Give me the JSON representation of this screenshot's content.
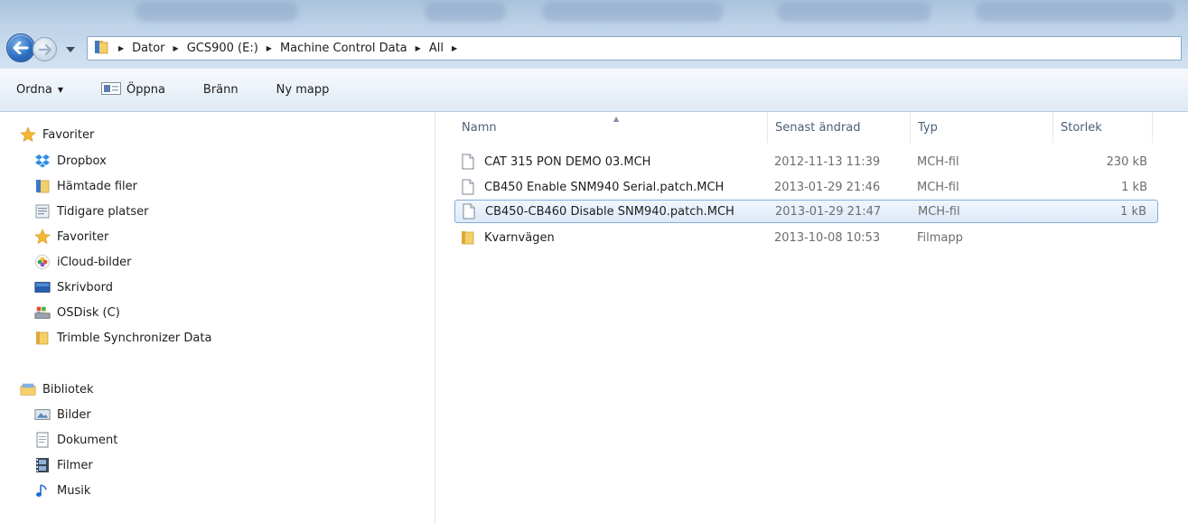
{
  "address": {
    "breadcrumbs": [
      "Dator",
      "GCS900 (E:)",
      "Machine Control Data",
      "All"
    ]
  },
  "commands": {
    "organize": "Ordna",
    "open": "Öppna",
    "burn": "Bränn",
    "new_folder": "Ny mapp"
  },
  "navpane": {
    "favorites_header": "Favoriter",
    "favorites": [
      "Dropbox",
      "Hämtade filer",
      "Tidigare platser",
      "Favoriter",
      "iCloud-bilder",
      "Skrivbord",
      "OSDisk (C)",
      "Trimble Synchronizer Data"
    ],
    "libraries_header": "Bibliotek",
    "libraries": [
      "Bilder",
      "Dokument",
      "Filmer",
      "Musik"
    ]
  },
  "columns": {
    "name": "Namn",
    "modified": "Senast ändrad",
    "type": "Typ",
    "size": "Storlek"
  },
  "files": [
    {
      "name": "CAT 315 PON DEMO 03.MCH",
      "modified": "2012-11-13 11:39",
      "type": "MCH-fil",
      "size": "230 kB",
      "icon": "file-icon"
    },
    {
      "name": "CB450 Enable SNM940 Serial.patch.MCH",
      "modified": "2013-01-29 21:46",
      "type": "MCH-fil",
      "size": "1 kB",
      "icon": "file-icon"
    },
    {
      "name": "CB450-CB460 Disable SNM940.patch.MCH",
      "modified": "2013-01-29 21:47",
      "type": "MCH-fil",
      "size": "1 kB",
      "icon": "file-icon",
      "selected": true
    },
    {
      "name": "Kvarnvägen",
      "modified": "2013-10-08 10:53",
      "type": "Filmapp",
      "size": "",
      "icon": "folder-icon"
    }
  ],
  "colors": {
    "accent": "#2b6fc2",
    "selection_border": "#84acdd",
    "folder": "#e8b84a"
  }
}
